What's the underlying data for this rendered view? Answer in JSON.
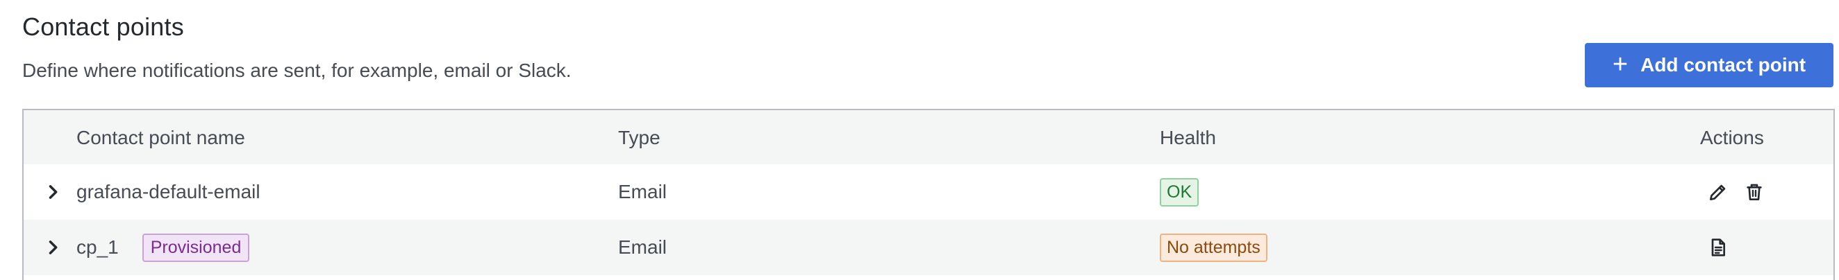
{
  "header": {
    "title": "Contact points",
    "subtitle": "Define where notifications are sent, for example, email or Slack.",
    "add_button_label": "Add contact point",
    "add_button_icon": "plus-icon",
    "accent_color": "#3d71d9"
  },
  "table": {
    "columns": [
      "Contact point name",
      "Type",
      "Health",
      "Actions"
    ],
    "rows": [
      {
        "name": "grafana-default-email",
        "badge": "",
        "type": "Email",
        "health": "OK",
        "actions": [
          "edit-icon",
          "trash-icon"
        ]
      },
      {
        "name": "cp_1",
        "badge": "Provisioned",
        "type": "Email",
        "health": "No attempts",
        "actions": [
          "document-icon"
        ]
      }
    ]
  }
}
